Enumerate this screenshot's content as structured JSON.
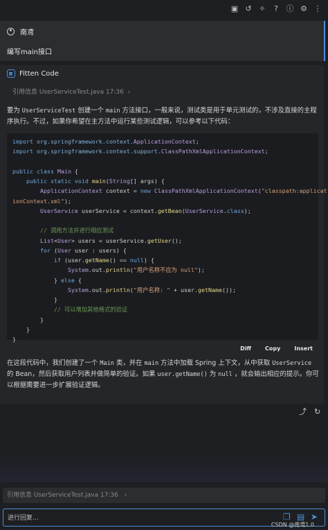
{
  "topbar": {
    "icons": [
      "chat-icon",
      "history-icon",
      "magic-icon",
      "help-icon",
      "info-icon",
      "settings-icon",
      "more-icon"
    ],
    "glyphs": [
      "▣",
      "↺",
      "✧",
      "?",
      "ⓘ",
      "⚙",
      "⋮"
    ]
  },
  "user_message": {
    "username": "南鸢",
    "text": "编写main接口"
  },
  "ai_message": {
    "name": "Fitten Code",
    "reference": "引用信息 UserServiceTest.java 17:36",
    "chevron": "›",
    "intro_parts": [
      "要为",
      "UserServiceTest",
      "创建一个",
      "main",
      "方法接口，一般来说，测试类是用于单元测试的，不涉及直接的主程序执行。不过，如果你希望在主方法中运行某些测试逻辑，可以参考以下代码："
    ],
    "code_actions": {
      "diff": "Diff",
      "copy": "Copy",
      "insert": "Insert"
    },
    "summary_parts": [
      "在这段代码中，我们创建了一个",
      "Main",
      "类，并在",
      "main",
      "方法中加载 Spring 上下文，从中获取",
      "UserService",
      "的 Bean，然后获取用户列表并做简单的验证。如果",
      "user.getName()",
      "为",
      "null",
      "，就会输出相应的提示。你可以根据需要进一步扩展验证逻辑。"
    ]
  },
  "footer": {
    "reference": "引用信息 UserServiceTest.java 17:36",
    "chevron": "›",
    "input_placeholder": "进行回复...",
    "watermark": "CSDN @南鸢1.0"
  },
  "colors": {
    "accent": "#4a90d9",
    "background": "#1e1f22",
    "panel": "#2b2d30"
  }
}
